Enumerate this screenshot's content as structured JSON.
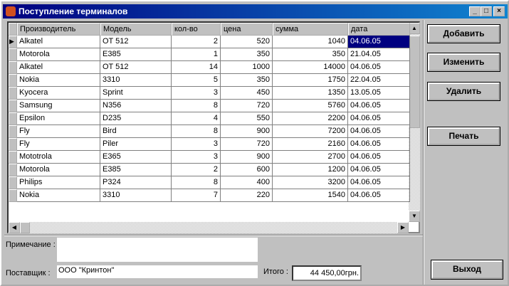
{
  "window": {
    "title": "Поступление терминалов",
    "min": "_",
    "max": "□",
    "close": "×"
  },
  "grid": {
    "columns": [
      "Производитель",
      "Модель",
      "кол-во",
      "цена",
      "сумма",
      "дата"
    ],
    "rows": [
      [
        "Alkatel",
        "OT 512",
        "2",
        "520",
        "1040",
        "04.06.05"
      ],
      [
        "Motorola",
        "E385",
        "1",
        "350",
        "350",
        "21.04.05"
      ],
      [
        "Alkatel",
        "OT 512",
        "14",
        "1000",
        "14000",
        "04.06.05"
      ],
      [
        "Nokia",
        "3310",
        "5",
        "350",
        "1750",
        "22.04.05"
      ],
      [
        "Kyocera",
        "Sprint",
        "3",
        "450",
        "1350",
        "13.05.05"
      ],
      [
        "Samsung",
        "N356",
        "8",
        "720",
        "5760",
        "04.06.05"
      ],
      [
        "Epsilon",
        "D235",
        "4",
        "550",
        "2200",
        "04.06.05"
      ],
      [
        "Fly",
        "Bird",
        "8",
        "900",
        "7200",
        "04.06.05"
      ],
      [
        "Fly",
        "Piler",
        "3",
        "720",
        "2160",
        "04.06.05"
      ],
      [
        "Mototrola",
        "E365",
        "3",
        "900",
        "2700",
        "04.06.05"
      ],
      [
        "Motorola",
        "E385",
        "2",
        "600",
        "1200",
        "04.06.05"
      ],
      [
        "Philips",
        "P324",
        "8",
        "400",
        "3200",
        "04.06.05"
      ],
      [
        "Nokia",
        "3310",
        "7",
        "220",
        "1540",
        "04.06.05"
      ]
    ]
  },
  "buttons": {
    "add": "Добавить",
    "edit": "Изменить",
    "delete": "Удалить",
    "print": "Печать",
    "exit": "Выход"
  },
  "form": {
    "note_label": "Примечание :",
    "note_value": "",
    "supplier_label": "Поставщик :",
    "supplier_value": "ООО \"Кринтон\"",
    "total_label": "Итого :",
    "total_value": "44 450,00грн."
  }
}
